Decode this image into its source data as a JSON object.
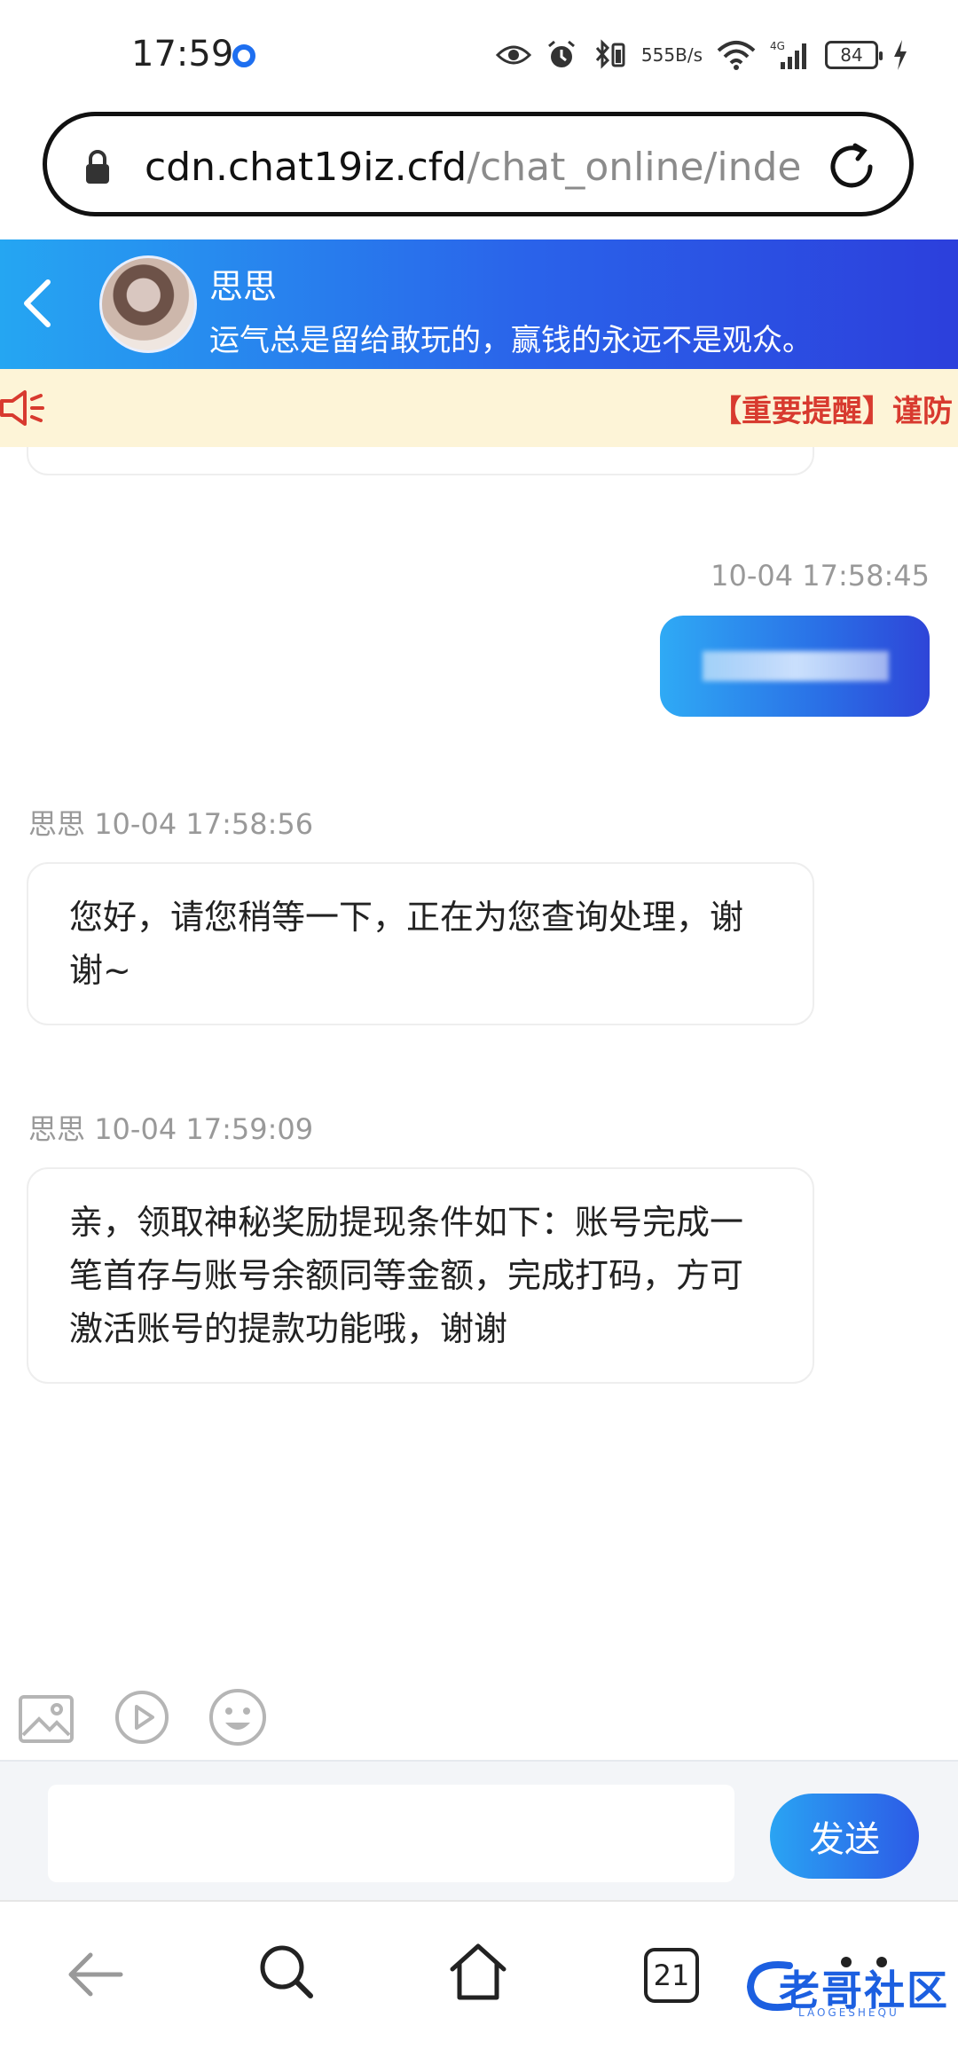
{
  "status_bar": {
    "time": "17:59",
    "net_speed_value": "555",
    "net_speed_unit": "B/s",
    "network": "4G",
    "battery": "84"
  },
  "browser": {
    "url_host": "cdn.chat19iz.cfd",
    "url_path": "/chat_online/inde",
    "tab_count": "21"
  },
  "chat_header": {
    "agent_name": "思思",
    "motto": "运气总是留给敢玩的，赢钱的永远不是观众。"
  },
  "notice": {
    "text": "【重要提醒】谨防"
  },
  "messages": [
    {
      "side": "right",
      "time": "10-04 17:58:45"
    },
    {
      "side": "left",
      "sender": "思思",
      "time": "10-04 17:58:56",
      "text": "您好，请您稍等一下，正在为您查询处理，谢谢~"
    },
    {
      "side": "left",
      "sender": "思思",
      "time": "10-04 17:59:09",
      "text": "亲，领取神秘奖励提现条件如下：账号完成一笔首存与账号余额同等金额，完成打码，方可激活账号的提款功能哦，谢谢"
    }
  ],
  "composer": {
    "placeholder": "",
    "send_label": "发送"
  },
  "watermark": {
    "text": "老哥社区",
    "sub": "LAOGESHEQU"
  },
  "icons": {
    "status": [
      "eye-icon",
      "alarm-icon",
      "bluetooth-icon",
      "wifi-icon",
      "signal-icon",
      "charging-icon"
    ],
    "toolbar": [
      "image-icon",
      "video-icon",
      "emoji-icon"
    ],
    "nav": [
      "back-arrow-icon",
      "search-icon",
      "home-icon",
      "tabs-icon",
      "more-icon"
    ]
  },
  "colors": {
    "header_gradient_start": "#25a6f2",
    "header_gradient_end": "#2c3fdc",
    "notice_bg": "#fdf4d7",
    "notice_text": "#d83a2f"
  }
}
